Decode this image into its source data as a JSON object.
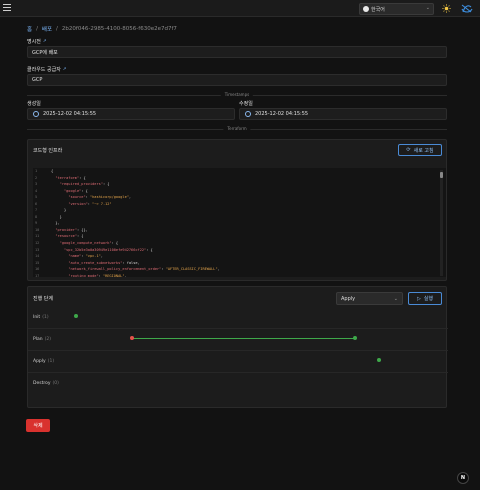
{
  "header": {
    "language": "한국어",
    "icons": [
      "menu-icon",
      "globe-icon",
      "chevron-down-icon",
      "sun-icon",
      "app-logo-icon"
    ]
  },
  "breadcrumb": {
    "home": "홈",
    "section": "배포",
    "current": "2b20f046-2985-4100-8056-f630e2e7d7f7",
    "separator": "/"
  },
  "fields": {
    "name_label": "명시전",
    "name_value": "GCP에 배포",
    "provider_label": "클라우드 공급자",
    "provider_value": "GCP",
    "timestamps_divider": "Timestamps",
    "created_label": "생성일",
    "created_value": "2025-12-02 04:15:55",
    "updated_label": "수정일",
    "updated_value": "2025-12-02 04:15:55",
    "terraform_divider": "Terraform"
  },
  "editor": {
    "title": "코드형 인프라",
    "refresh_label": "새로 고침",
    "lines": [
      {
        "n": "1",
        "t": "{"
      },
      {
        "n": "2",
        "t": "  \"terraform\": {"
      },
      {
        "n": "3",
        "t": "    \"required_providers\": {"
      },
      {
        "n": "4",
        "t": "      \"google\": {"
      },
      {
        "n": "5",
        "t": "        \"source\": \"hashicorp/google\","
      },
      {
        "n": "6",
        "t": "        \"version\": \"~> 7.12\""
      },
      {
        "n": "7",
        "t": "      }"
      },
      {
        "n": "8",
        "t": "    }"
      },
      {
        "n": "9",
        "t": "  },"
      },
      {
        "n": "10",
        "t": "  \"provider\": {},"
      },
      {
        "n": "11",
        "t": "  \"resource\": {"
      },
      {
        "n": "12",
        "t": "    \"google_compute_network\": {"
      },
      {
        "n": "13",
        "t": "      \"vpc_32b5e3a0a30949e1100efe942766cf22\": {"
      },
      {
        "n": "14",
        "t": "        \"name\": \"vpc-1\","
      },
      {
        "n": "15",
        "t": "        \"auto_create_subnetworks\": false,"
      },
      {
        "n": "16",
        "t": "        \"network_firewall_policy_enforcement_order\": \"AFTER_CLASSIC_FIREWALL\","
      },
      {
        "n": "17",
        "t": "        \"routing_mode\": \"REGIONAL\","
      },
      {
        "n": "18",
        "t": "        \"bgp_best_path_selection_mode\": \"LEGACY\""
      }
    ]
  },
  "stages": {
    "title": "진행 단계",
    "select_value": "Apply",
    "run_label": "실행",
    "items": [
      {
        "name": "Init",
        "count": "(1)"
      },
      {
        "name": "Plan",
        "count": "(2)"
      },
      {
        "name": "Apply",
        "count": "(1)"
      },
      {
        "name": "Destroy",
        "count": "(0)"
      }
    ],
    "colors": {
      "success": "#3ea84a",
      "failed": "#e5534b"
    }
  },
  "actions": {
    "delete_label": "삭제",
    "help_label": "N"
  }
}
